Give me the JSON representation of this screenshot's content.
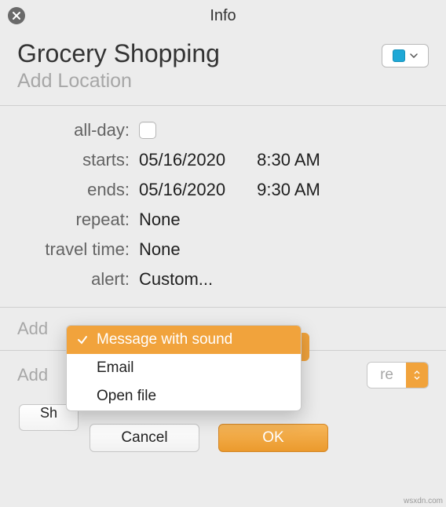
{
  "titlebar": {
    "title": "Info"
  },
  "event": {
    "title": "Grocery Shopping",
    "location_placeholder": "Add Location"
  },
  "fields": {
    "allday_label": "all-day:",
    "starts_label": "starts:",
    "starts_date": "05/16/2020",
    "starts_time": "8:30 AM",
    "ends_label": "ends:",
    "ends_date": "05/16/2020",
    "ends_time": "9:30 AM",
    "repeat_label": "repeat:",
    "repeat_value": "None",
    "travel_label": "travel time:",
    "travel_value": "None",
    "alert_label": "alert:",
    "alert_value": "Custom..."
  },
  "sections": {
    "add_notes_placeholder": "Add",
    "add_attachments_placeholder": "Add"
  },
  "more_selector": {
    "label": "re"
  },
  "popup": {
    "items": [
      {
        "label": "Message with sound",
        "selected": true
      },
      {
        "label": "Email",
        "selected": false
      },
      {
        "label": "Open file",
        "selected": false
      }
    ]
  },
  "buttons": {
    "cancel": "Cancel",
    "ok": "OK",
    "show": "Sh"
  },
  "colors": {
    "calendar_swatch": "#1ea8d6",
    "accent": "#f1a33c"
  },
  "watermark": "wsxdn.com"
}
